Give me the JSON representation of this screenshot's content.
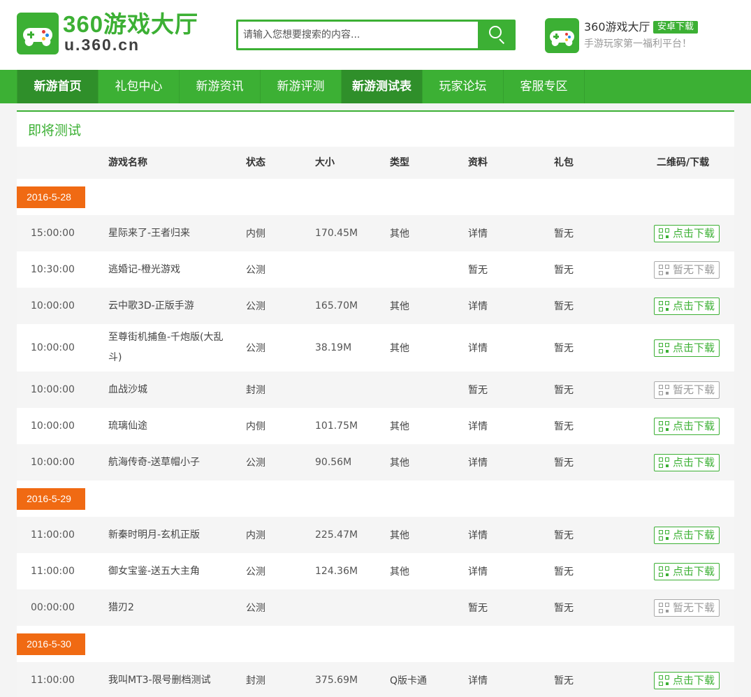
{
  "brand": {
    "title": "360游戏大厅",
    "url": "u.360.cn"
  },
  "search": {
    "placeholder": "请输入您想要搜索的内容..."
  },
  "app": {
    "name": "360游戏大厅",
    "download_label": "安卓下载",
    "slogan": "手游玩家第一福利平台！"
  },
  "colors": {
    "accent": "#3cb034",
    "date_tag": "#f06a13"
  },
  "nav": [
    {
      "label": "新游首页",
      "active": true
    },
    {
      "label": "礼包中心",
      "active": false
    },
    {
      "label": "新游资讯",
      "active": false
    },
    {
      "label": "新游评测",
      "active": false
    },
    {
      "label": "新游测试表",
      "active": true
    },
    {
      "label": "玩家论坛",
      "active": false
    },
    {
      "label": "客服专区",
      "active": false
    }
  ],
  "section": {
    "title": "即将测试"
  },
  "columns": {
    "name": "游戏名称",
    "status": "状态",
    "size": "大小",
    "type": "类型",
    "info": "资料",
    "gift": "礼包",
    "download": "二维码/下载"
  },
  "groups": [
    {
      "date": "2016-5-28",
      "rows": [
        {
          "time": "15:00:00",
          "name": "星际来了-王者归来",
          "status": "内侧",
          "size": "170.45M",
          "type": "其他",
          "info": "详情",
          "gift": "暂无",
          "download": "点击下载",
          "available": true
        },
        {
          "time": "10:30:00",
          "name": "逃婚记-橙光游戏",
          "status": "公测",
          "size": "",
          "type": "",
          "info": "暂无",
          "gift": "暂无",
          "download": "暂无下载",
          "available": false
        },
        {
          "time": "10:00:00",
          "name": "云中歌3D-正版手游",
          "status": "公测",
          "size": "165.70M",
          "type": "其他",
          "info": "详情",
          "gift": "暂无",
          "download": "点击下载",
          "available": true
        },
        {
          "time": "10:00:00",
          "name": "至尊街机捕鱼-千炮版(大乱斗)",
          "status": "公测",
          "size": "38.19M",
          "type": "其他",
          "info": "详情",
          "gift": "暂无",
          "download": "点击下载",
          "available": true
        },
        {
          "time": "10:00:00",
          "name": "血战沙城",
          "status": "封测",
          "size": "",
          "type": "",
          "info": "暂无",
          "gift": "暂无",
          "download": "暂无下载",
          "available": false
        },
        {
          "time": "10:00:00",
          "name": "琉璃仙途",
          "status": "内侧",
          "size": "101.75M",
          "type": "其他",
          "info": "详情",
          "gift": "暂无",
          "download": "点击下载",
          "available": true
        },
        {
          "time": "10:00:00",
          "name": "航海传奇-送草帽小子",
          "status": "公测",
          "size": "90.56M",
          "type": "其他",
          "info": "详情",
          "gift": "暂无",
          "download": "点击下载",
          "available": true
        }
      ]
    },
    {
      "date": "2016-5-29",
      "rows": [
        {
          "time": "11:00:00",
          "name": "新秦时明月-玄机正版",
          "status": "内测",
          "size": "225.47M",
          "type": "其他",
          "info": "详情",
          "gift": "暂无",
          "download": "点击下载",
          "available": true
        },
        {
          "time": "11:00:00",
          "name": "御女宝鉴-送五大主角",
          "status": "公测",
          "size": "124.36M",
          "type": "其他",
          "info": "详情",
          "gift": "暂无",
          "download": "点击下载",
          "available": true
        },
        {
          "time": "00:00:00",
          "name": "猎刃2",
          "status": "公测",
          "size": "",
          "type": "",
          "info": "暂无",
          "gift": "暂无",
          "download": "暂无下载",
          "available": false
        }
      ]
    },
    {
      "date": "2016-5-30",
      "rows": [
        {
          "time": "11:00:00",
          "name": "我叫MT3-限号删档测试",
          "status": "封测",
          "size": "375.69M",
          "type": "Q版卡通",
          "info": "详情",
          "gift": "暂无",
          "download": "点击下载",
          "available": true
        }
      ]
    }
  ]
}
